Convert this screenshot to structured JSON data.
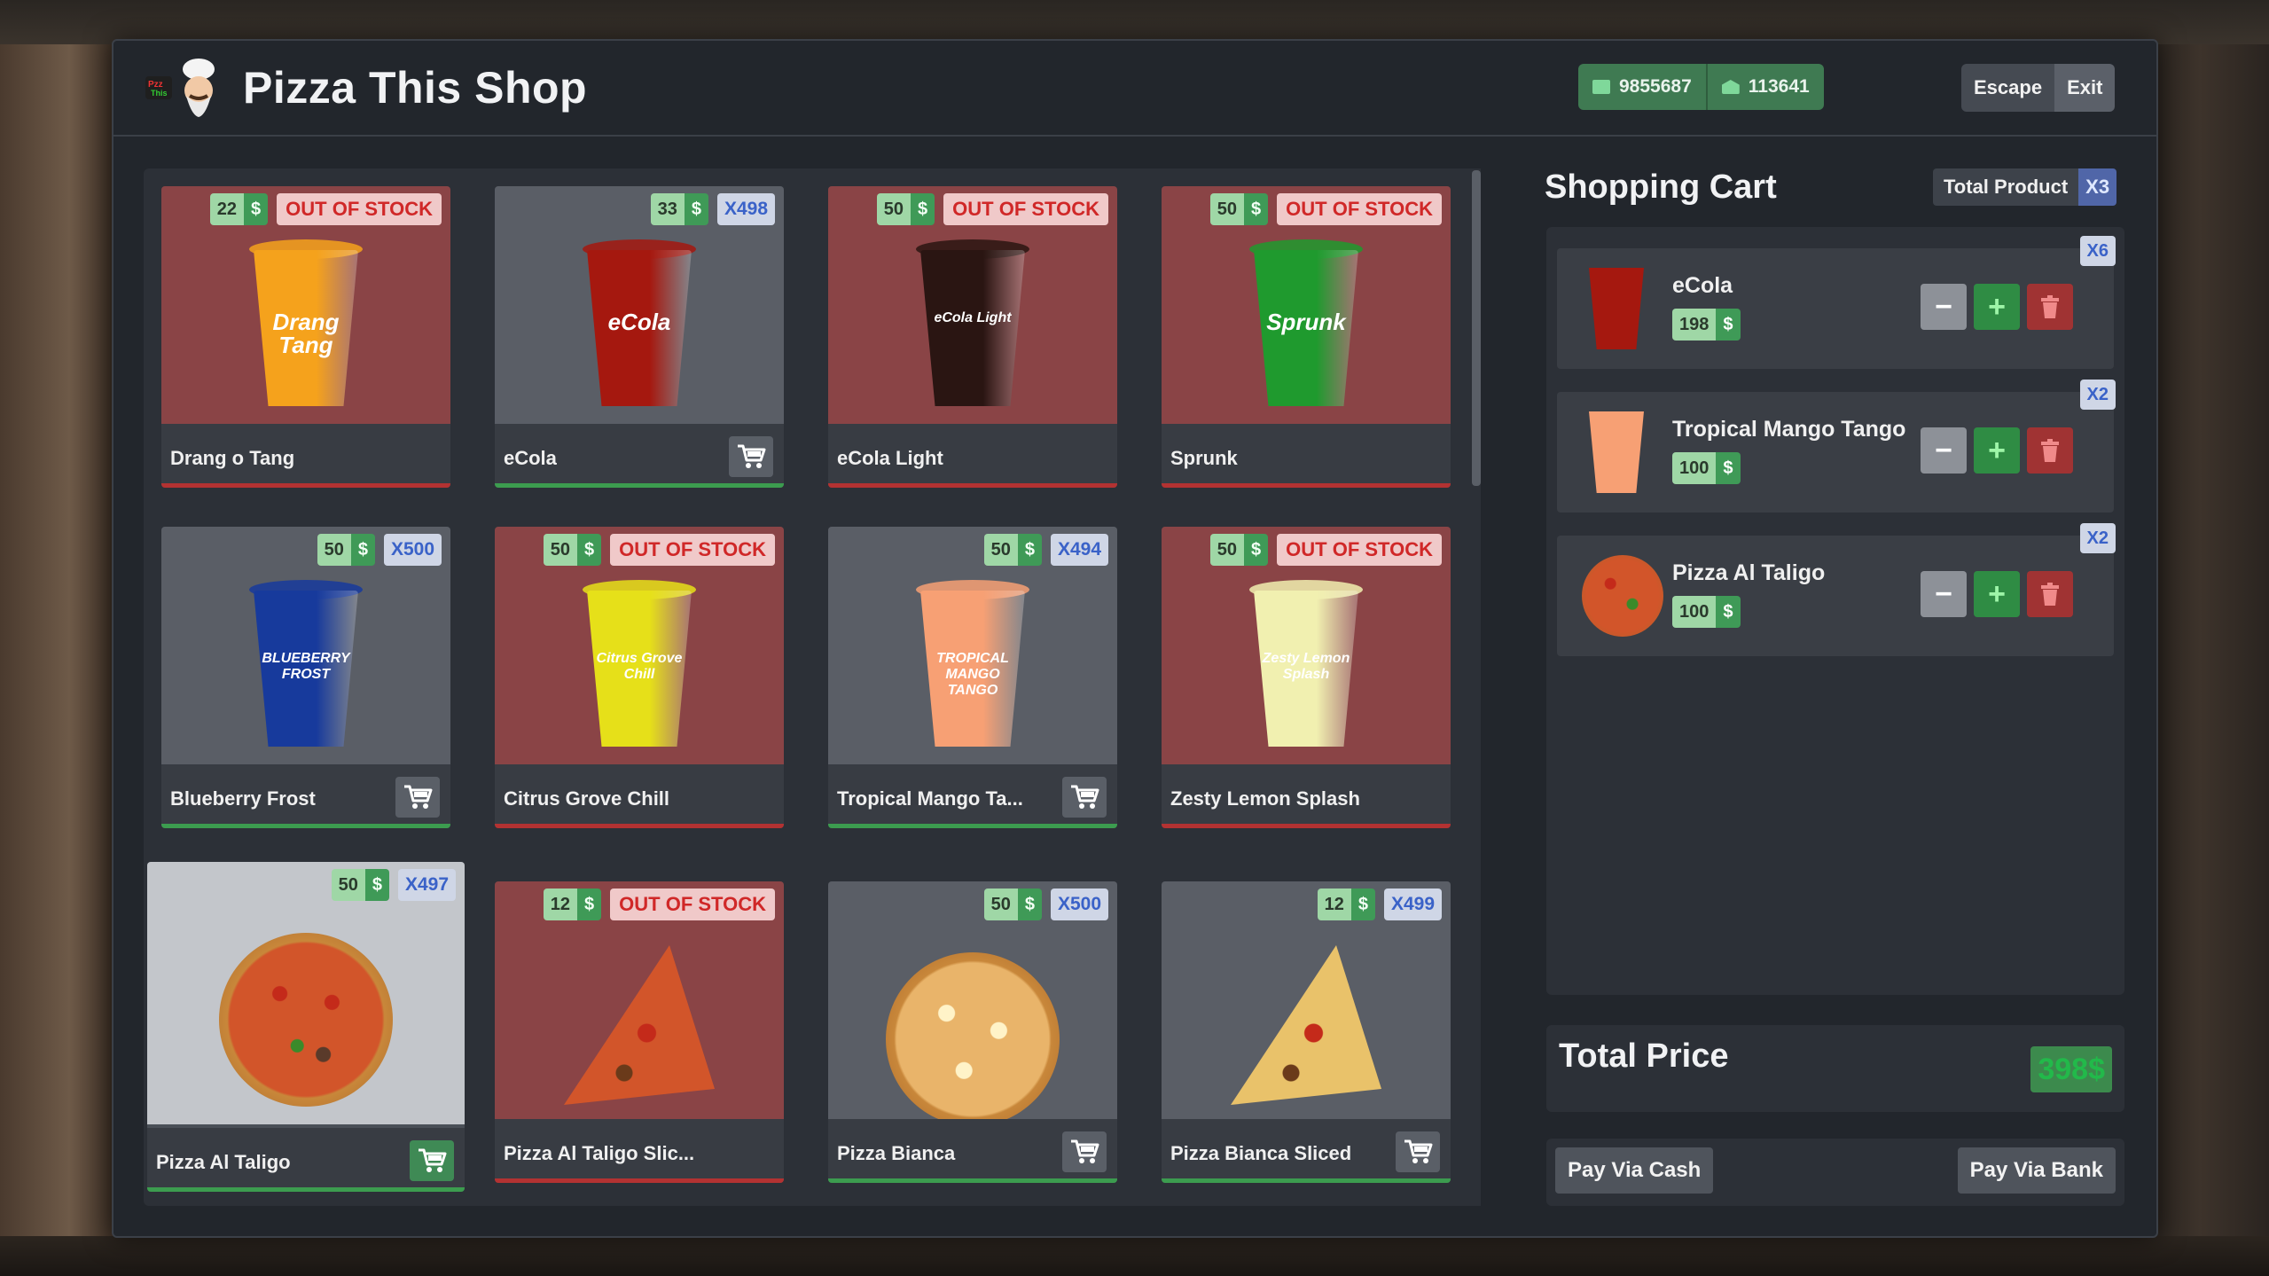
{
  "header": {
    "title": "Pizza This Shop",
    "cash": "9855687",
    "bank": "113641",
    "escape_label": "Escape",
    "exit_label": "Exit"
  },
  "currency_symbol": "$",
  "products": [
    {
      "name": "Drang o Tang",
      "price": "22",
      "status": "OUT OF STOCK",
      "stock": "",
      "art": "cup",
      "color": "#f5a21c"
    },
    {
      "name": "eCola",
      "price": "33",
      "status": "",
      "stock": "X498",
      "art": "cup",
      "color": "#a5180f"
    },
    {
      "name": "eCola Light",
      "price": "50",
      "status": "OUT OF STOCK",
      "stock": "",
      "art": "cup",
      "color": "#2a1512"
    },
    {
      "name": "Sprunk",
      "price": "50",
      "status": "OUT OF STOCK",
      "stock": "",
      "art": "cup",
      "color": "#1f9a2e"
    },
    {
      "name": "Blueberry Frost",
      "price": "50",
      "status": "",
      "stock": "X500",
      "art": "cup",
      "color": "#173a9c"
    },
    {
      "name": "Citrus Grove Chill",
      "price": "50",
      "status": "OUT OF STOCK",
      "stock": "",
      "art": "cup",
      "color": "#e6e019"
    },
    {
      "name": "Tropical Mango Ta...",
      "price": "50",
      "status": "",
      "stock": "X494",
      "art": "cup",
      "color": "#f7a074"
    },
    {
      "name": "Zesty Lemon Splash",
      "price": "50",
      "status": "OUT OF STOCK",
      "stock": "",
      "art": "cup",
      "color": "#f1f0b0"
    },
    {
      "name": "Pizza Al Taligo",
      "price": "50",
      "status": "",
      "stock": "X497",
      "art": "pizza",
      "color": "#d2552a"
    },
    {
      "name": "Pizza Al Taligo Slic...",
      "price": "12",
      "status": "OUT OF STOCK",
      "stock": "",
      "art": "slice",
      "color": "#d2552a"
    },
    {
      "name": "Pizza Bianca",
      "price": "50",
      "status": "",
      "stock": "X500",
      "art": "pizza",
      "color": "#e9b46a"
    },
    {
      "name": "Pizza Bianca Sliced",
      "price": "12",
      "status": "",
      "stock": "X499",
      "art": "slice",
      "color": "#e9c26a"
    }
  ],
  "cart": {
    "title": "Shopping Cart",
    "total_product_label": "Total Product",
    "total_product_count": "X3",
    "items": [
      {
        "name": "eCola",
        "price": "198",
        "qty": "X6",
        "art": "cup",
        "color": "#a5180f"
      },
      {
        "name": "Tropical Mango Tango",
        "price": "100",
        "qty": "X2",
        "art": "cup",
        "color": "#f7a074"
      },
      {
        "name": "Pizza Al Taligo",
        "price": "100",
        "qty": "X2",
        "art": "pizza",
        "color": "#d2552a"
      }
    ],
    "total_price_label": "Total Price",
    "total_price": "398$",
    "pay_cash_label": "Pay Via Cash",
    "pay_bank_label": "Pay Via Bank"
  },
  "drink_labels": [
    "Drang Tang",
    "eCola",
    "eCola Light",
    "Sprunk",
    "BLUEBERRY FROST",
    "Citrus Grove Chill",
    "TROPICAL MANGO TANGO",
    "Zesty Lemon Splash"
  ]
}
